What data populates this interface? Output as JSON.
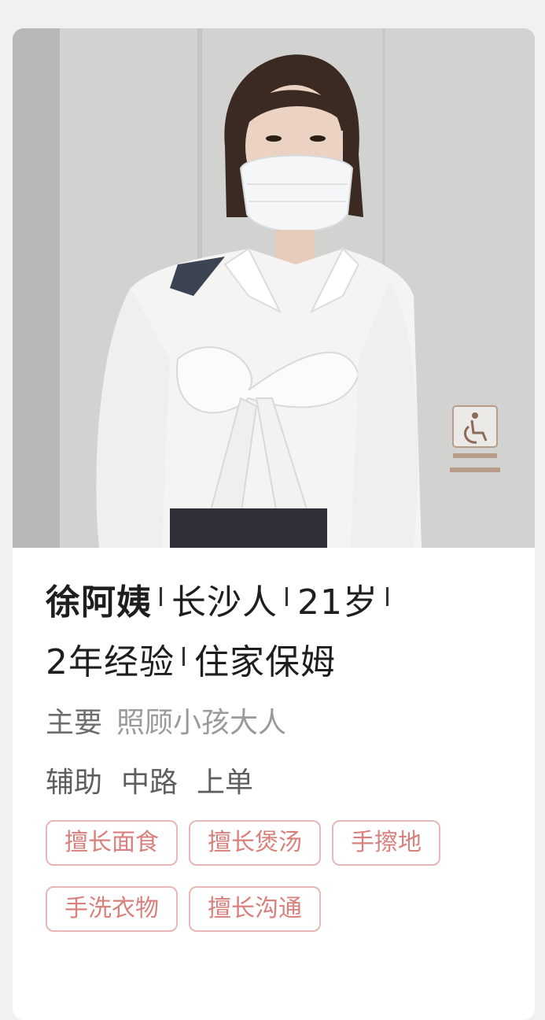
{
  "profile": {
    "name": "徐阿姨",
    "hometown": "长沙人",
    "age": "21岁",
    "experience": "2年经验",
    "job_type": "住家保姆",
    "care_label": "主要",
    "care_value": "照顾小孩大人",
    "roles": [
      "辅助",
      "中路",
      "上单"
    ],
    "tags": [
      "擅长面食",
      "擅长煲汤",
      "手擦地",
      "手洗衣物",
      "擅长沟通"
    ]
  },
  "colors": {
    "tag_text": "#d9807c",
    "tag_border": "#e8b6b6",
    "background": "#f1f1f1"
  }
}
